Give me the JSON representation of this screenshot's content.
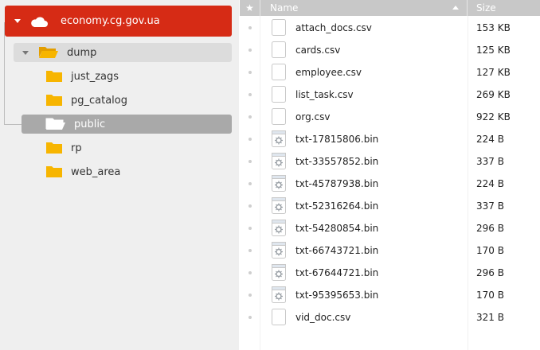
{
  "tree": {
    "root": {
      "label": "economy.cg.gov.ua",
      "icon": "cloud-icon"
    },
    "nodes": [
      {
        "label": "dump",
        "state": "expanded"
      },
      {
        "label": "just_zags"
      },
      {
        "label": "pg_catalog"
      },
      {
        "label": "public",
        "state": "selected"
      },
      {
        "label": "rp"
      },
      {
        "label": "web_area"
      }
    ]
  },
  "list": {
    "header": {
      "star": "★",
      "name": "Name",
      "size": "Size",
      "sort": "ascending"
    },
    "files": [
      {
        "name": "attach_docs.csv",
        "size": "153 KB",
        "type": "csv"
      },
      {
        "name": "cards.csv",
        "size": "125 KB",
        "type": "csv"
      },
      {
        "name": "employee.csv",
        "size": "127 KB",
        "type": "csv"
      },
      {
        "name": "list_task.csv",
        "size": "269 KB",
        "type": "csv"
      },
      {
        "name": "org.csv",
        "size": "922 KB",
        "type": "csv"
      },
      {
        "name": "txt-17815806.bin",
        "size": "224 B",
        "type": "bin"
      },
      {
        "name": "txt-33557852.bin",
        "size": "337 B",
        "type": "bin"
      },
      {
        "name": "txt-45787938.bin",
        "size": "224 B",
        "type": "bin"
      },
      {
        "name": "txt-52316264.bin",
        "size": "337 B",
        "type": "bin"
      },
      {
        "name": "txt-54280854.bin",
        "size": "296 B",
        "type": "bin"
      },
      {
        "name": "txt-66743721.bin",
        "size": "170 B",
        "type": "bin"
      },
      {
        "name": "txt-67644721.bin",
        "size": "296 B",
        "type": "bin"
      },
      {
        "name": "txt-95395653.bin",
        "size": "170 B",
        "type": "bin"
      },
      {
        "name": "vid_doc.csv",
        "size": "321 B",
        "type": "csv"
      }
    ]
  },
  "colors": {
    "accent": "#d62b15",
    "selected": "#a9a9a9",
    "folder": "#f7b500",
    "header": "#c8c8c8"
  }
}
